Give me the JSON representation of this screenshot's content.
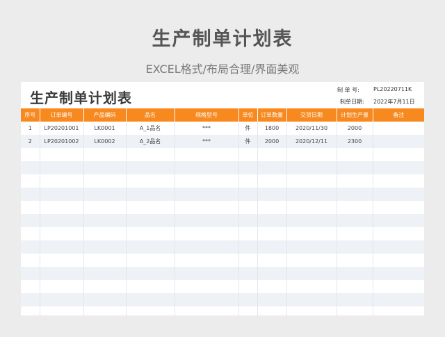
{
  "header": {
    "title": "生产制单计划表",
    "subtitle": "EXCEL格式/布局合理/界面美观"
  },
  "sheet": {
    "title": "生产制单计划表",
    "order_no_label": "制    单    号:",
    "order_no_value": "PL20220711K",
    "date_label": "制单日期:",
    "date_value": "2022年7月11日"
  },
  "table": {
    "columns": [
      "序号",
      "订单编号",
      "产品编码",
      "品名",
      "规格型号",
      "单位",
      "订单数量",
      "交货日期",
      "计划生产量",
      "备注"
    ],
    "rows": [
      [
        "1",
        "LP20201001",
        "LK0001",
        "A_1品名",
        "***",
        "件",
        "1800",
        "2020/11/30",
        "2000",
        ""
      ],
      [
        "2",
        "LP20201002",
        "LK0002",
        "A_2品名",
        "***",
        "件",
        "2000",
        "2020/12/11",
        "2300",
        ""
      ],
      [
        "",
        "",
        "",
        "",
        "",
        "",
        "",
        "",
        "",
        ""
      ],
      [
        "",
        "",
        "",
        "",
        "",
        "",
        "",
        "",
        "",
        ""
      ],
      [
        "",
        "",
        "",
        "",
        "",
        "",
        "",
        "",
        "",
        ""
      ],
      [
        "",
        "",
        "",
        "",
        "",
        "",
        "",
        "",
        "",
        ""
      ],
      [
        "",
        "",
        "",
        "",
        "",
        "",
        "",
        "",
        "",
        ""
      ],
      [
        "",
        "",
        "",
        "",
        "",
        "",
        "",
        "",
        "",
        ""
      ],
      [
        "",
        "",
        "",
        "",
        "",
        "",
        "",
        "",
        "",
        ""
      ],
      [
        "",
        "",
        "",
        "",
        "",
        "",
        "",
        "",
        "",
        ""
      ],
      [
        "",
        "",
        "",
        "",
        "",
        "",
        "",
        "",
        "",
        ""
      ],
      [
        "",
        "",
        "",
        "",
        "",
        "",
        "",
        "",
        "",
        ""
      ],
      [
        "",
        "",
        "",
        "",
        "",
        "",
        "",
        "",
        "",
        ""
      ],
      [
        "",
        "",
        "",
        "",
        "",
        "",
        "",
        "",
        "",
        ""
      ],
      [
        "",
        "",
        "",
        "",
        "",
        "",
        "",
        "",
        "",
        ""
      ]
    ]
  },
  "colors": {
    "header_bg": "#f7891f",
    "stripe": "#eef1f6",
    "page_bg": "#ececec"
  }
}
